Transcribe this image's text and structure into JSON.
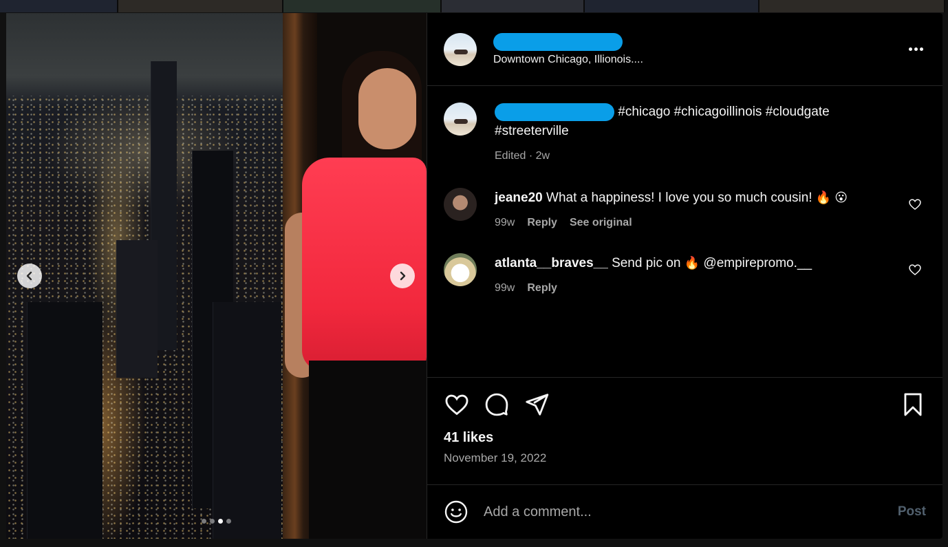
{
  "post": {
    "location": "Downtown Chicago, Illionois....",
    "caption": "#chicago #chicagoillinois #cloudgate",
    "caption_line2": "#streeterville",
    "caption_meta": "Edited · 2w",
    "likes": "41 likes",
    "date": "November 19, 2022"
  },
  "carousel": {
    "prev_icon": "chevron-left-icon",
    "next_icon": "chevron-right-icon",
    "slide_count": 4,
    "active_index": 2
  },
  "comments": [
    {
      "username": "jeane20",
      "text": "What a happiness! I love you so much cousin!",
      "emojis": "🔥 😮",
      "time": "99w",
      "reply": "Reply",
      "see_original": "See original"
    },
    {
      "username": "atlanta__braves__",
      "text_before": "Send pic on",
      "emoji": "🔥",
      "text_after": "@empirepromo.__",
      "time": "99w",
      "reply": "Reply"
    }
  ],
  "composer": {
    "placeholder": "Add a comment...",
    "post_label": "Post"
  },
  "colors": {
    "redaction": "#0a9ee8",
    "background": "#000000",
    "muted_text": "#a8a8a8",
    "post_disabled": "#51606e"
  }
}
